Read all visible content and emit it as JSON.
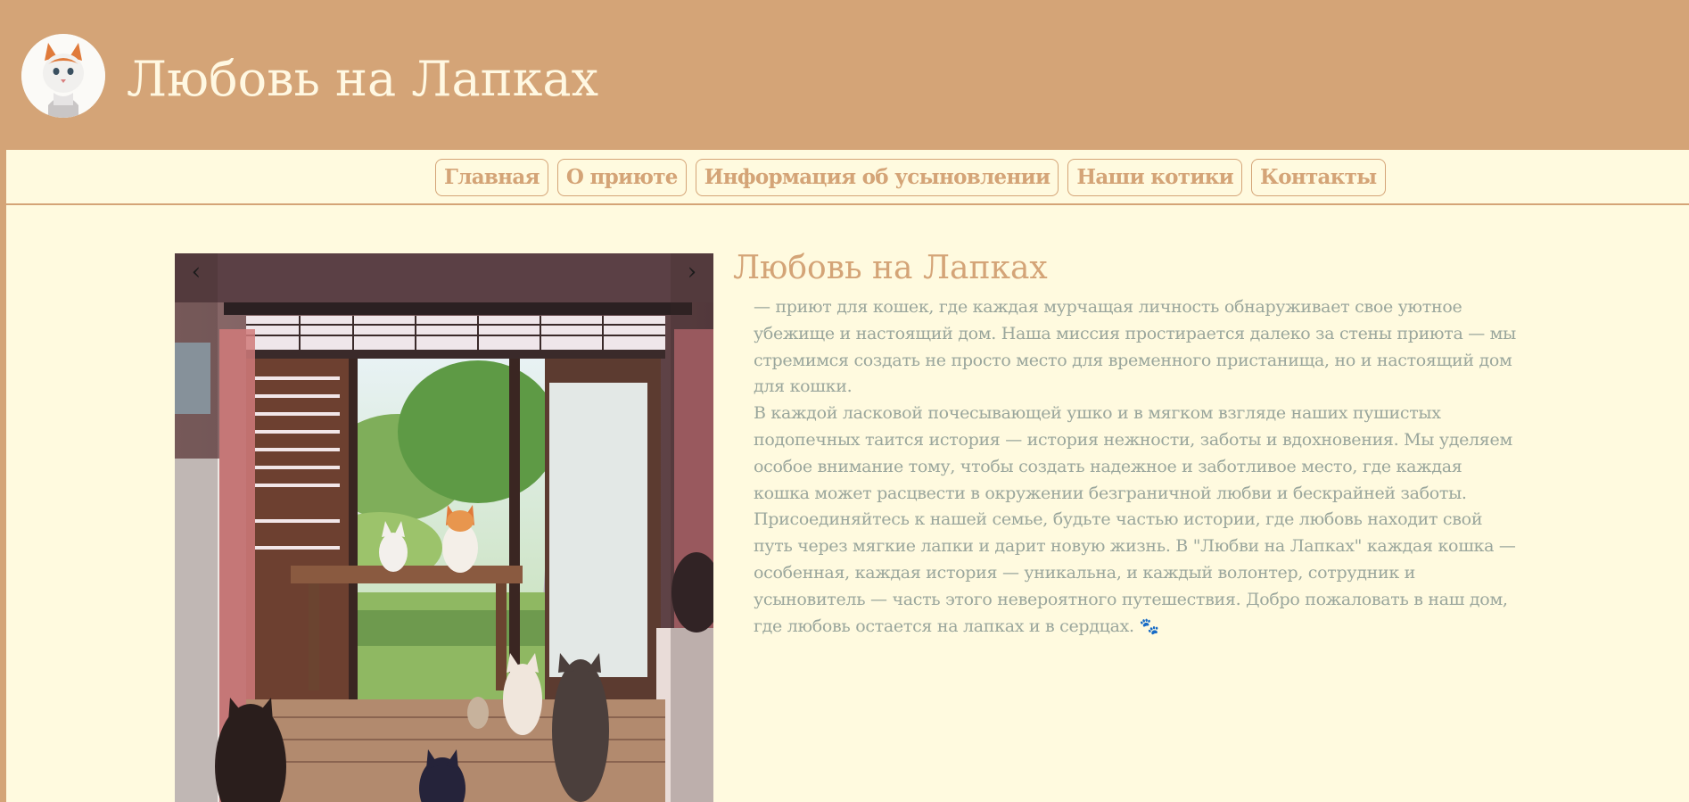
{
  "header": {
    "site_title": "Любовь на Лапках"
  },
  "nav": {
    "items": [
      {
        "label": "Главная"
      },
      {
        "label": "О приюте"
      },
      {
        "label": "Информация об усыновлении"
      },
      {
        "label": "Наши котики"
      },
      {
        "label": "Контакты"
      }
    ]
  },
  "slider": {
    "prev_label": "‹",
    "next_label": "›"
  },
  "about": {
    "heading": "Любовь на Лапках",
    "paragraph1": "— приют для кошек, где каждая мурчащая личность обнаруживает свое уютное убежище и настоящий дом. Наша миссия простирается далеко за стены приюта — мы стремимся создать не просто место для временного пристанища, но и настоящий дом для кошки.",
    "paragraph2": "В каждой ласковой почесывающей ушко и в мягком взгляде наших пушистых подопечных таится история — история нежности, заботы и вдохновения. Мы уделяем особое внимание тому, чтобы создать надежное и заботливое место, где каждая кошка может расцвести в окружении безграничной любви и бескрайней заботы.",
    "paragraph3": "Присоединяйтесь к нашей семье, будьте частью истории, где любовь находит свой путь через мягкие лапки и дарит новую жизнь. В \"Любви на Лапках\" каждая кошка — особенная, каждая история — уникальна, и каждый волонтер, сотрудник и усыновитель — часть этого невероятного путешествия. Добро пожаловать в наш дом, где любовь остается на лапках и в сердцах.",
    "paw_emoji": "🐾"
  },
  "colors": {
    "header_bg": "#d4a477",
    "page_bg": "#fffadf",
    "text": "#9aa69c"
  }
}
